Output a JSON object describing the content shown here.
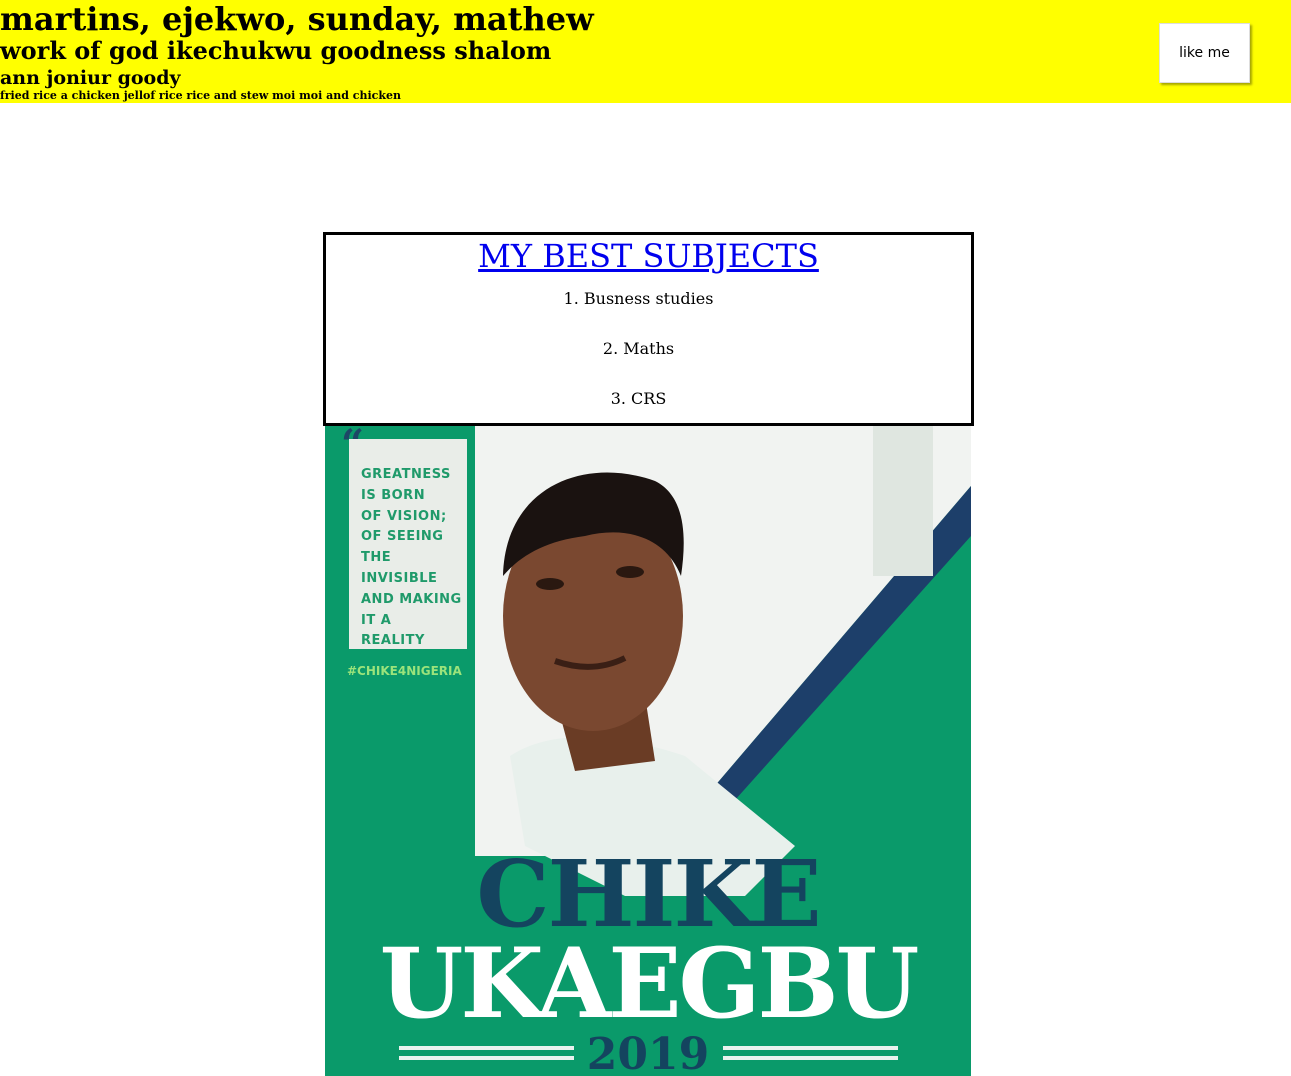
{
  "header": {
    "line1": "martins, ejekwo, sunday, mathew",
    "line2": "work of god ikechukwu goodness shalom",
    "line3": "ann joniur goody",
    "line4": "fried rice a chicken jellof rice rice and stew moi moi and chicken",
    "like_button": "like me",
    "bg_color": "#ffff00"
  },
  "subjects": {
    "title": "MY BEST SUBJECTS",
    "items": [
      "1. Busness studies",
      "2. Maths",
      "3. CRS"
    ]
  },
  "poster": {
    "quote_marks": "“",
    "quote": "GREATNESS\nIS BORN\nOF VISION;\nOF SEEING\nTHE\nINVISIBLE\nAND MAKING\nIT A\nREALITY",
    "hashtag": "#CHIKE4NIGERIA",
    "name_first": "CHIKE",
    "name_last": "UKAEGBU",
    "year": "2019",
    "colors": {
      "green": "#0a9a6a",
      "navy": "#14445f"
    }
  }
}
